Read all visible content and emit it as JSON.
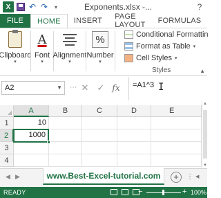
{
  "window": {
    "title": "Exponents.xlsx -...",
    "help": "?"
  },
  "qat": {
    "app_icon": "X",
    "icons": [
      "excel-logo-icon",
      "save-icon",
      "undo-icon",
      "redo-icon",
      "customize-qat-icon"
    ]
  },
  "tabs": [
    {
      "label": "FILE"
    },
    {
      "label": "HOME"
    },
    {
      "label": "INSERT"
    },
    {
      "label": "PAGE LAYOUT"
    },
    {
      "label": "FORMULAS"
    }
  ],
  "ribbon": {
    "clipboard": "Clipboard",
    "font": "Font",
    "alignment": "Alignment",
    "number": "Number",
    "number_symbol": "%",
    "font_symbol": "A",
    "styles": {
      "conditional": "Conditional Formattin",
      "format_table": "Format as Table",
      "cell_styles": "Cell Styles",
      "group_label": "Styles"
    }
  },
  "formula_bar": {
    "name_box": "A2",
    "cancel": "✕",
    "enter": "✓",
    "fx": "fx",
    "formula": "=A1^3"
  },
  "grid": {
    "columns": [
      "A",
      "B",
      "C",
      "D",
      "E"
    ],
    "rows": [
      "1",
      "2",
      "3",
      "4"
    ],
    "cells": {
      "A1": "10",
      "A2": "1000"
    },
    "active_cell": "A2"
  },
  "sheet_tab": {
    "label": "www.Best-Excel-tutorial.com",
    "add": "+"
  },
  "status": {
    "ready": "READY",
    "zoom_minus": "−",
    "zoom_plus": "+",
    "zoom": "100%"
  },
  "colors": {
    "excel_green": "#217346",
    "accent_text": "#217346"
  }
}
